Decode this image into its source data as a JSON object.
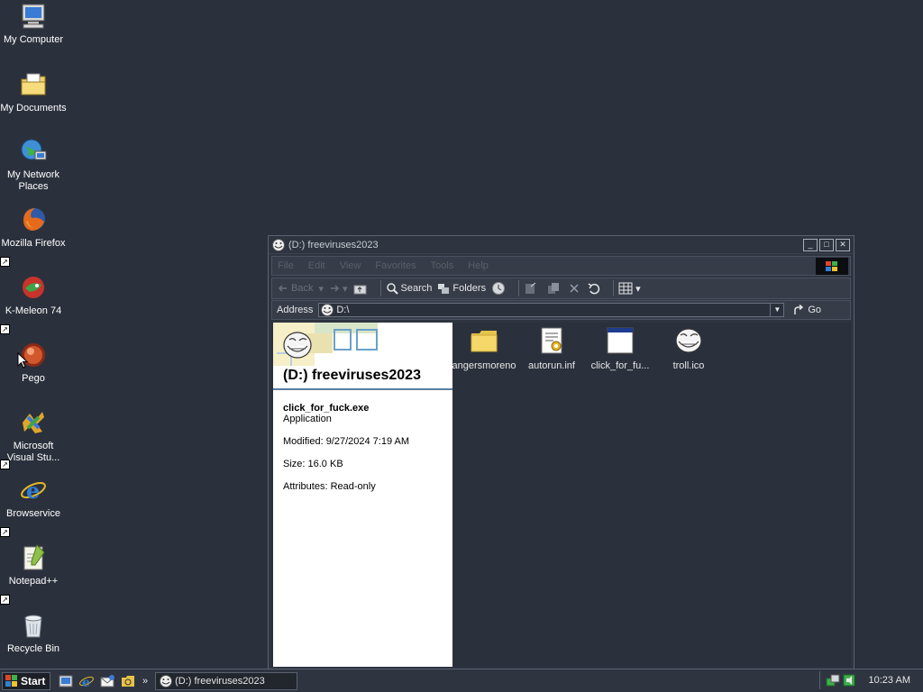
{
  "desktop": {
    "icons": [
      {
        "label": "My Computer",
        "icon": "computer-icon"
      },
      {
        "label": "My Documents",
        "icon": "documents-folder-icon"
      },
      {
        "label": "My Network Places",
        "icon": "network-icon"
      },
      {
        "label": "Mozilla Firefox",
        "icon": "firefox-icon"
      },
      {
        "label": "K-Meleon 74",
        "icon": "kmeleon-icon"
      },
      {
        "label": "Pego",
        "icon": "pego-icon"
      },
      {
        "label": "Microsoft Visual Stu...",
        "icon": "visual-studio-icon"
      },
      {
        "label": "Browservice",
        "icon": "ie-icon"
      },
      {
        "label": "Notepad++",
        "icon": "notepadpp-icon"
      },
      {
        "label": "Recycle Bin",
        "icon": "recycle-bin-icon"
      }
    ]
  },
  "window": {
    "title": "(D:) freeviruses2023",
    "menu": [
      "File",
      "Edit",
      "View",
      "Favorites",
      "Tools",
      "Help"
    ],
    "toolbar": {
      "back": "Back",
      "search": "Search",
      "folders": "Folders"
    },
    "address": {
      "label": "Address",
      "value": "D:\\",
      "go": "Go"
    },
    "webview": {
      "title": "(D:) freeviruses2023",
      "selected_name": "click_for_fuck.exe",
      "selected_type": "Application",
      "modified": "Modified: 9/27/2024 7:19 AM",
      "size": "Size: 16.0 KB",
      "attributes": "Attributes: Read-only"
    },
    "files": [
      {
        "name": "angersmoreno",
        "icon": "folder-icon"
      },
      {
        "name": "autorun.inf",
        "icon": "settings-file-icon"
      },
      {
        "name": "click_for_fu...",
        "icon": "exe-window-icon"
      },
      {
        "name": "troll.ico",
        "icon": "trollface-icon"
      }
    ]
  },
  "taskbar": {
    "start": "Start",
    "task": "(D:) freeviruses2023",
    "clock": "10:23 AM",
    "chevron": "»"
  }
}
